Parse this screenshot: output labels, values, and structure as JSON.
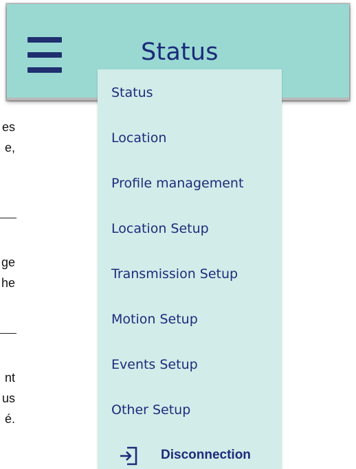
{
  "header": {
    "title": "Status"
  },
  "background": {
    "fragments": [
      "es",
      "e,",
      "ge",
      "he",
      "nt",
      "us",
      "é."
    ]
  },
  "menu": {
    "items": [
      {
        "label": "Status"
      },
      {
        "label": "Location"
      },
      {
        "label": "Profile management"
      },
      {
        "label": "Location Setup"
      },
      {
        "label": "Transmission Setup"
      },
      {
        "label": "Motion Setup"
      },
      {
        "label": "Events Setup"
      },
      {
        "label": "Other Setup"
      }
    ],
    "disconnect_label": "Disconnection",
    "disconnect_icon": "logout-icon"
  },
  "colors": {
    "header_bg": "#99d9d2",
    "drawer_bg": "#d2ece9",
    "text_accent": "#1d2b7c"
  }
}
